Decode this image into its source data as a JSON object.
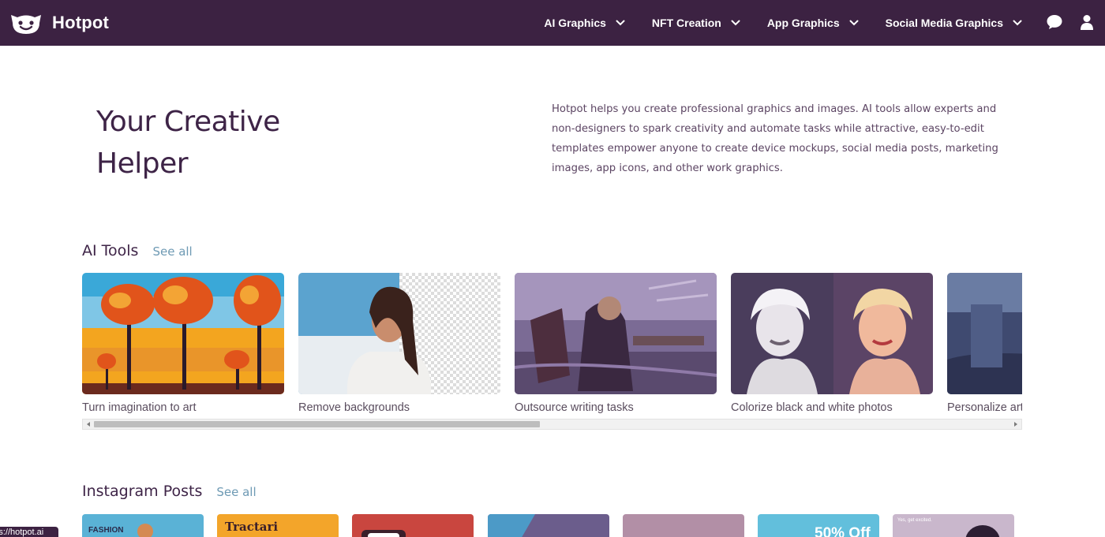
{
  "nav": {
    "brand": "Hotpot",
    "menu": [
      {
        "label": "AI Graphics"
      },
      {
        "label": "NFT Creation"
      },
      {
        "label": "App Graphics"
      },
      {
        "label": "Social Media Graphics"
      }
    ],
    "icons": [
      "chat-icon",
      "user-icon"
    ],
    "background": "#3c2242"
  },
  "hero": {
    "title_line1": "Your Creative",
    "title_line2": "Helper",
    "description": "Hotpot helps you create professional graphics and images. AI tools allow experts and non-designers to spark creativity and automate tasks while attractive, easy-to-edit templates empower anyone to create device mockups, social media posts, marketing images, app icons, and other work graphics."
  },
  "ai_tools": {
    "title": "AI Tools",
    "see_all": "See all",
    "cards": [
      {
        "label": "Turn imagination to art"
      },
      {
        "label": "Remove backgrounds"
      },
      {
        "label": "Outsource writing tasks"
      },
      {
        "label": "Colorize black and white photos"
      },
      {
        "label": "Personalize art"
      }
    ]
  },
  "instagram": {
    "title": "Instagram Posts",
    "see_all": "See all",
    "cards": [
      {
        "text": "FASHION",
        "color": "#5ab2d6"
      },
      {
        "text": "Tractari",
        "color": "#f3a52a"
      },
      {
        "text": "",
        "color": "#c9463f"
      },
      {
        "text": "",
        "color": "#6b5d8c"
      },
      {
        "text": "",
        "color": "#b28fa6"
      },
      {
        "text": "50% Off",
        "color": "#62bfdc"
      },
      {
        "text": "Yes, get excited.",
        "color": "#c9b7cc"
      }
    ]
  },
  "status_url": "https://hotpot.ai",
  "colors": {
    "accent": "#3c2242",
    "link": "#6e9ab4"
  }
}
